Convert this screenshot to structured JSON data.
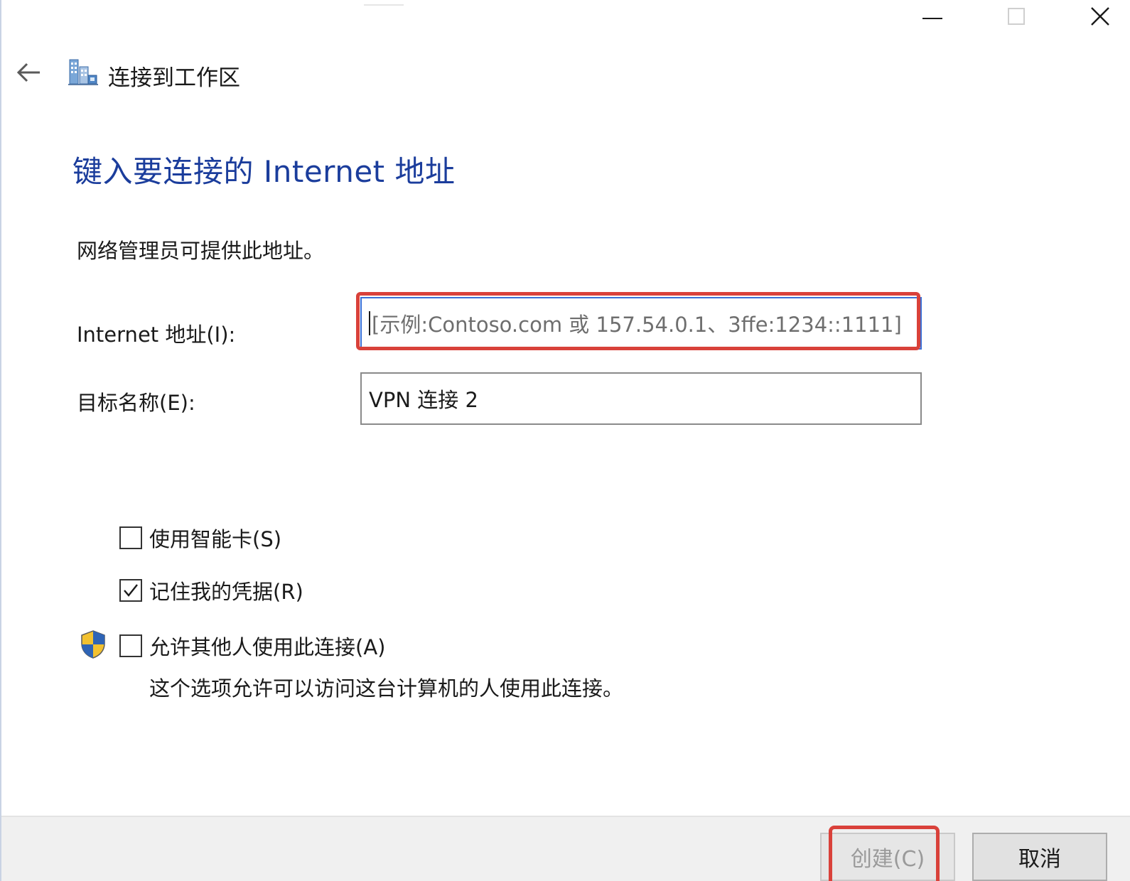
{
  "window": {
    "minimize_icon": "minimize-icon",
    "maximize_icon": "maximize-icon",
    "close_icon": "close-icon"
  },
  "header": {
    "back_icon": "back-arrow-icon",
    "app_icon": "workplace-network-icon",
    "title": "连接到工作区"
  },
  "main": {
    "heading": "键入要连接的 Internet 地址",
    "description": "网络管理员可提供此地址。",
    "address_label": "Internet 地址(I):",
    "address_placeholder": "[示例:Contoso.com 或 157.54.0.1、3ffe:1234::1111]",
    "address_value": "",
    "name_label": "目标名称(E):",
    "name_value": "VPN 连接 2"
  },
  "options": {
    "smart_card_label": "使用智能卡(S)",
    "smart_card_checked": false,
    "remember_label": "记住我的凭据(R)",
    "remember_checked": true,
    "allow_label": "允许其他人使用此连接(A)",
    "allow_checked": false,
    "allow_note": "这个选项允许可以访问这台计算机的人使用此连接。",
    "shield_icon": "uac-shield-icon"
  },
  "footer": {
    "create_label": "创建(C)",
    "create_enabled": false,
    "cancel_label": "取消"
  },
  "colors": {
    "heading": "#1b3d9c",
    "highlight": "#d9413a",
    "focus_border": "#3a6fd6"
  }
}
